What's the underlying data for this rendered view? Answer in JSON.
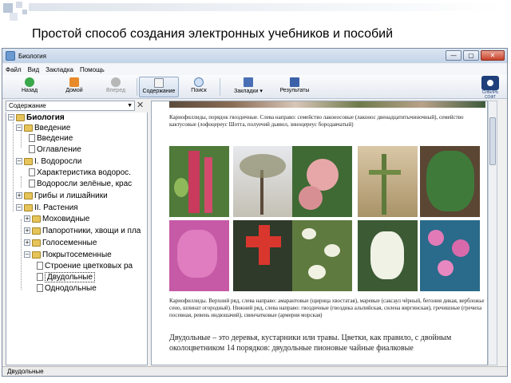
{
  "slide": {
    "title": "Простой способ создания электронных учебников и пособий"
  },
  "window": {
    "title": "Биология",
    "min": "—",
    "max": "▢",
    "close": "✕"
  },
  "menu": [
    "Файл",
    "Вид",
    "Закладка",
    "Помощь"
  ],
  "toolbar": {
    "back": "Назад",
    "home": "Домой",
    "forward": "Вперед",
    "contents": "Содержание",
    "search": "Поиск",
    "bookmarks": "Закладки",
    "results": "Результаты",
    "logo_text": "СИБИРЬ СОФТ"
  },
  "sidebar": {
    "header": "Содержание",
    "tree": [
      {
        "label": "Биология",
        "bold": true
      },
      {
        "label": "Введение"
      },
      {
        "label": "Введение"
      },
      {
        "label": "Оглавление"
      },
      {
        "label": "I. Водоросли"
      },
      {
        "label": "Характеристика водорос."
      },
      {
        "label": "Водоросли зелёные, крас"
      },
      {
        "label": "Грибы и лишайники"
      },
      {
        "label": "II. Растения"
      },
      {
        "label": "Моховидные"
      },
      {
        "label": "Папоротники, хвощи и пла"
      },
      {
        "label": "Голосеменные"
      },
      {
        "label": "Покрытосеменные"
      },
      {
        "label": "Строение цветковых ра"
      },
      {
        "label": "Двудольные",
        "selected": true
      },
      {
        "label": "Однодольные"
      }
    ]
  },
  "content": {
    "caption_top": "Кариофиллиды, порядок гвоздичные. Слева направо: семейство лаконосовые (лаконос двенадцатитычиночный), семейство кактусовые (лофоцереус Шотта, полуечий дьявол, зиноцереус бородавчатый)",
    "caption_bottom": "Кариофиллиды. Верхний ряд, слева направо: амарантовые (щирица хвостатая), маревые (саксаул чёрный, бегония дикая, вербложье сено, шпинат огородный). Нижний ряд, слева направо: гвоздичные (гвоздика альпийская, силена виргинская), гречишные (гречиха посевная, ревень индюшачий), свинчатковые (армерия морская)",
    "paragraph": "Двудольные – это деревья, кустарники или травы. Цветки, как правило, с двойным околоцветником 14 порядков: двудольные пионовые чайные фиалковые"
  },
  "status": "Двудольные"
}
